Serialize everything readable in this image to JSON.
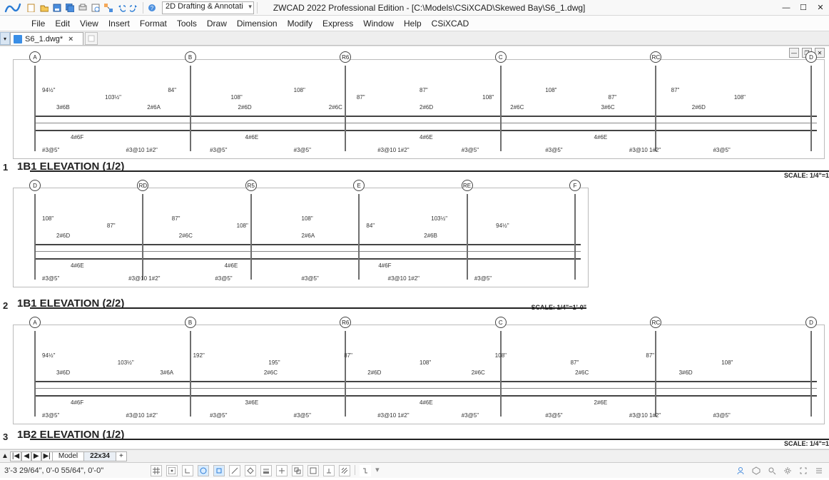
{
  "app": {
    "title": "ZWCAD 2022 Professional Edition - [C:\\Models\\CSiXCAD\\Skewed Bay\\S6_1.dwg]",
    "workspace": "2D Drafting & Annotati"
  },
  "menu": [
    "File",
    "Edit",
    "View",
    "Insert",
    "Format",
    "Tools",
    "Draw",
    "Dimension",
    "Modify",
    "Express",
    "Window",
    "Help",
    "CSiXCAD"
  ],
  "tab": {
    "name": "S6_1.dwg*"
  },
  "layouts": {
    "nav": [
      "|◀",
      "◀",
      "▶",
      "▶|"
    ],
    "model": "Model",
    "active": "22x34",
    "add": "+"
  },
  "status": {
    "coords": "3'-3 29/64\", 0'-0 55/64\", 0'-0\""
  },
  "panels": {
    "p1": {
      "idx": "1",
      "title": "1B1 ELEVATION (1/2)",
      "scale": "SCALE: 1/4\"=1",
      "grids": [
        "A",
        "B",
        "R6",
        "C",
        "RC",
        "D"
      ],
      "dims_top": [
        "94½\"",
        "103½\"",
        "84\"",
        "108\"",
        "108\"",
        "87\"",
        "87\"",
        "108\"",
        "108\"",
        "87\"",
        "87\"",
        "108\""
      ],
      "rebar": [
        "3#6B",
        "2#6A",
        "2#6D",
        "2#6C",
        "2#6D",
        "2#6C",
        "3#6C",
        "2#6D"
      ],
      "dims_bot": [
        "4#6F",
        "4#6E",
        "4#6E",
        "4#6E"
      ],
      "secs": [
        "#3@5\"",
        "#3@10 1#2\"",
        "#3@5\"",
        "#3@5\"",
        "#3@10 1#2\"",
        "#3@5\"",
        "#3@5\"",
        "#3@10 1#2\"",
        "#3@5\""
      ]
    },
    "p2": {
      "idx": "2",
      "title": "1B1 ELEVATION (2/2)",
      "scale": "SCALE: 1/4\"=1'-0\"",
      "grids": [
        "D",
        "RD",
        "R5",
        "E",
        "RE",
        "F"
      ],
      "dims_top": [
        "108\"",
        "87\"",
        "87\"",
        "108\"",
        "108\"",
        "84\"",
        "103½\"",
        "94½\""
      ],
      "rebar": [
        "2#6D",
        "2#6C",
        "2#6A",
        "2#6B"
      ],
      "dims_bot": [
        "4#6E",
        "4#6E",
        "4#6F"
      ],
      "secs": [
        "#3@5\"",
        "#3@10 1#2\"",
        "#3@5\"",
        "#3@5\"",
        "#3@10 1#2\"",
        "#3@5\""
      ]
    },
    "p3": {
      "idx": "3",
      "title": "1B2 ELEVATION (1/2)",
      "scale": "SCALE: 1/4\"=1",
      "grids": [
        "A",
        "B",
        "R6",
        "C",
        "RC",
        "D"
      ],
      "dims_top": [
        "94½\"",
        "103½\"",
        "192\"",
        "195\"",
        "87\"",
        "108\"",
        "108\"",
        "87\"",
        "87\"",
        "108\""
      ],
      "rebar": [
        "3#6D",
        "3#6A",
        "2#6C",
        "2#6D",
        "2#6C",
        "2#6C",
        "3#6D"
      ],
      "dims_bot": [
        "4#6F",
        "3#6E",
        "4#6E",
        "2#6E"
      ],
      "secs": [
        "#3@5\"",
        "#3@10 1#2\"",
        "#3@5\"",
        "#3@5\"",
        "#3@10 1#2\"",
        "#3@5\"",
        "#3@5\"",
        "#3@10 1#2\"",
        "#3@5\""
      ]
    }
  }
}
